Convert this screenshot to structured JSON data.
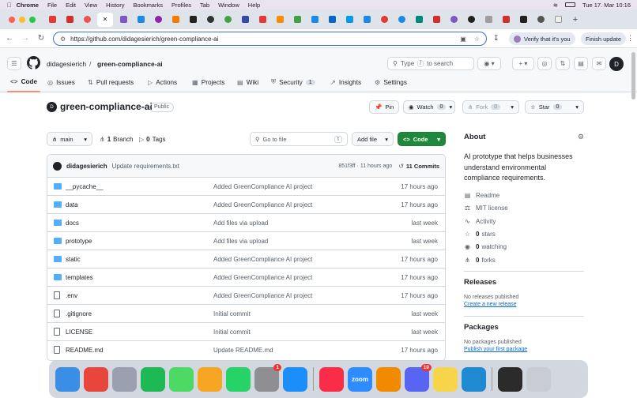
{
  "menubar": {
    "app": "Chrome",
    "items": [
      "File",
      "Edit",
      "View",
      "History",
      "Bookmarks",
      "Profiles",
      "Tab",
      "Window",
      "Help"
    ],
    "clock": "Tue 17. Mar  10:16"
  },
  "browser": {
    "url": "https://github.com/didagesierich/green-compliance-ai",
    "verify_label": "Verify that it's you",
    "finish_label": "Finish update"
  },
  "github": {
    "owner": "didagesierich",
    "separator": "/",
    "repo": "green-compliance-ai",
    "search_prefix": "Type",
    "search_key": "/",
    "search_suffix": "to search",
    "avatar_letter": "D",
    "tabs": [
      {
        "label": "Code",
        "icon": "code-icon"
      },
      {
        "label": "Issues",
        "icon": "issue-icon"
      },
      {
        "label": "Pull requests",
        "icon": "pull-request-icon"
      },
      {
        "label": "Actions",
        "icon": "play-icon"
      },
      {
        "label": "Projects",
        "icon": "table-icon"
      },
      {
        "label": "Wiki",
        "icon": "book-icon"
      },
      {
        "label": "Security",
        "icon": "shield-icon",
        "count": "1"
      },
      {
        "label": "Insights",
        "icon": "graph-icon"
      },
      {
        "label": "Settings",
        "icon": "gear-icon"
      }
    ]
  },
  "repo": {
    "owner_initial": "D",
    "name": "green-compliance-ai",
    "visibility": "Public",
    "pin_label": "Pin",
    "watch_label": "Watch",
    "watch_count": "0",
    "fork_label": "Fork",
    "fork_count": "0",
    "star_label": "Star",
    "star_count": "0",
    "branch": "main",
    "branches": "1",
    "branches_label": "Branch",
    "tags": "0",
    "tags_label": "Tags",
    "goto_placeholder": "Go to file",
    "goto_key": "t",
    "add_file_label": "Add file",
    "code_label": "Code"
  },
  "commit": {
    "author": "didagesierich",
    "message": "Update requirements.txt",
    "meta": "851f3ff · 11 hours ago",
    "count": "11 Commits"
  },
  "files": [
    {
      "name": "__pycache__",
      "type": "folder",
      "message": "Added GreenCompliance AI project",
      "date": "17 hours ago"
    },
    {
      "name": "data",
      "type": "folder",
      "message": "Added GreenCompliance AI project",
      "date": "17 hours ago"
    },
    {
      "name": "docs",
      "type": "folder",
      "message": "Add files via upload",
      "date": "last week"
    },
    {
      "name": "prototype",
      "type": "folder",
      "message": "Add files via upload",
      "date": "last week"
    },
    {
      "name": "static",
      "type": "folder",
      "message": "Added GreenCompliance AI project",
      "date": "17 hours ago"
    },
    {
      "name": "templates",
      "type": "folder",
      "message": "Added GreenCompliance AI project",
      "date": "17 hours ago"
    },
    {
      "name": ".env",
      "type": "file",
      "message": "Added GreenCompliance AI project",
      "date": "17 hours ago"
    },
    {
      "name": ".gitignore",
      "type": "file",
      "message": "Initial commit",
      "date": "last week"
    },
    {
      "name": "LICENSE",
      "type": "file",
      "message": "Initial commit",
      "date": "last week"
    },
    {
      "name": "README.md",
      "type": "file",
      "message": "Update README.md",
      "date": "17 hours ago"
    }
  ],
  "about": {
    "title": "About",
    "description": "AI prototype that helps businesses understand environmental compliance requirements.",
    "links": [
      {
        "icon": "book-icon",
        "label": "Readme"
      },
      {
        "icon": "law-icon",
        "label": "MIT license"
      },
      {
        "icon": "pulse-icon",
        "label": "Activity"
      },
      {
        "icon": "star-icon",
        "bold": "0",
        "label": "stars"
      },
      {
        "icon": "eye-icon",
        "bold": "0",
        "label": "watching"
      },
      {
        "icon": "fork-icon",
        "bold": "0",
        "label": "forks"
      }
    ],
    "releases_title": "Releases",
    "releases_text": "No releases published",
    "releases_link": "Create a new release",
    "packages_title": "Packages",
    "packages_text": "No packages published",
    "packages_link": "Publish your first package"
  },
  "dock": {
    "apps": [
      {
        "name": "finder-icon",
        "color": "#3a8ee6"
      },
      {
        "name": "chrome-icon",
        "color": "#e8453c"
      },
      {
        "name": "launchpad-icon",
        "color": "#9aa0b0"
      },
      {
        "name": "spotify-icon",
        "color": "#1db954"
      },
      {
        "name": "messages-icon",
        "color": "#4cd964"
      },
      {
        "name": "photos-icon",
        "color": "#f6a623"
      },
      {
        "name": "whatsapp-icon",
        "color": "#25d366"
      },
      {
        "name": "system-settings-icon",
        "color": "#8e8e93",
        "badge": "1"
      },
      {
        "name": "app-store-icon",
        "color": "#1c8ef9"
      },
      {
        "name": "music-icon",
        "color": "#fa2d48"
      },
      {
        "name": "zoom-icon",
        "color": "#2d8cff",
        "text": "zoom"
      },
      {
        "name": "vlc-icon",
        "color": "#f28a00"
      },
      {
        "name": "discord-icon",
        "color": "#5865f2",
        "badge": "10"
      },
      {
        "name": "notes-icon",
        "color": "#f7d54a"
      },
      {
        "name": "vscode-icon",
        "color": "#1f8ad2"
      },
      {
        "name": "terminal-icon",
        "color": "#2b2b2b"
      },
      {
        "name": "trash-icon",
        "color": "#c9ccd2"
      }
    ]
  }
}
